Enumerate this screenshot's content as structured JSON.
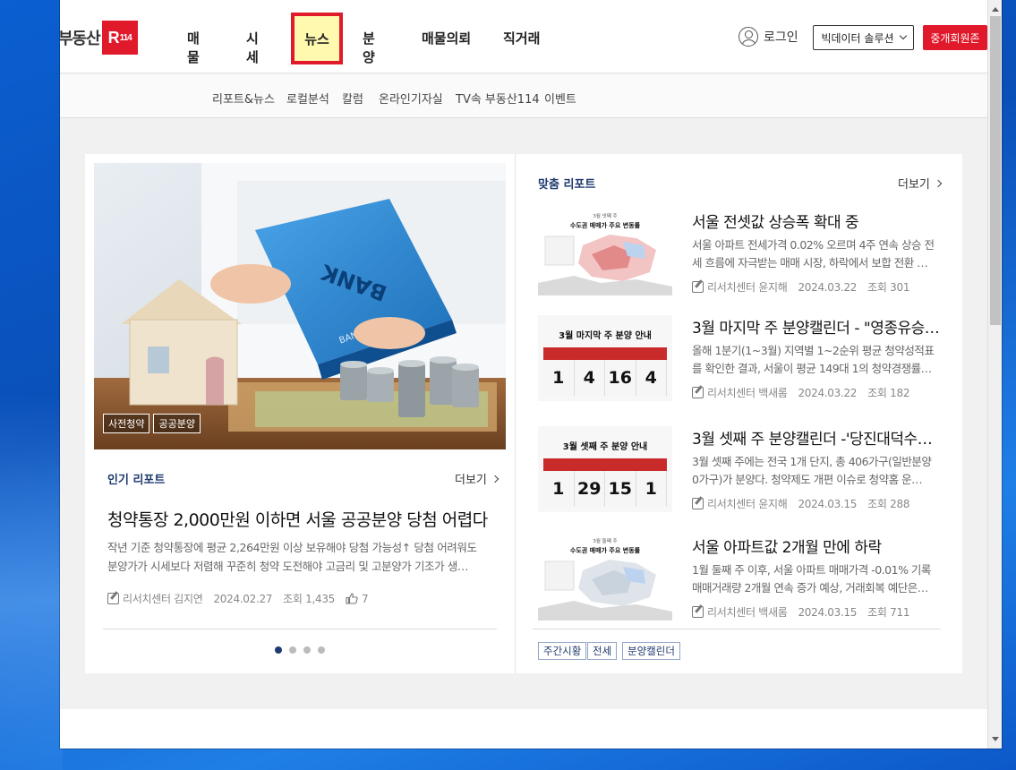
{
  "header": {
    "logo_text": "부동산",
    "logo_box": "R",
    "logo_box_small": "114",
    "nav": [
      "매물",
      "시세",
      "뉴스",
      "분양",
      "매물의뢰",
      "직거래"
    ],
    "login": "로그인",
    "bigdata_label": "빅데이터 솔루션",
    "agent_label": "중개회원존"
  },
  "subnav": [
    "리포트&뉴스",
    "로컬분석",
    "칼럼",
    "온라인기자실",
    "TV속 부동산114",
    "이벤트"
  ],
  "popular": {
    "section_label": "인기 리포트",
    "more": "더보기",
    "tags": [
      "사전청약",
      "공공분양"
    ],
    "title": "청약통장 2,000만원 이하면 서울 공공분양 당첨 어렵다",
    "desc_lines": [
      "작년 기준 청약통장에 평균 2,264만원 이상 보유해야 당첨 가능성↑ 당첨 어려워도",
      "분양가가 시세보다 저렴해 꾸준히 청약 도전해야 고금리 및 고분양가 기조가 생…"
    ],
    "author": "리서치센터 김지연",
    "date": "2024.02.27",
    "views": "조회 1,435",
    "likes": "7",
    "bank_text": "BANK",
    "bank_text2": "BANK"
  },
  "reports": {
    "section_label": "맞춤 리포트",
    "more": "더보기",
    "items": [
      {
        "title": "서울 전셋값 상승폭 확대 중",
        "desc_lines": [
          "서울 아파트 전세가격 0.02% 오르며 4주 연속 상승 전",
          "세 흐름에 자극받는 매매 시장, 하락에서 보합 전환 …"
        ],
        "author": "리서치센터 윤지해",
        "date": "2024.03.22",
        "views": "조회 301",
        "thumb_title_small": "3월 넷째 주",
        "thumb_title": "수도권 매매가 주요 변동률"
      },
      {
        "title": "3월 마지막 주 분양캘린더 - \"영종유승한내들…",
        "desc_lines": [
          "올해 1분기(1~3월) 지역별 1~2순위 평균 청약성적표",
          "를 확인한 결과, 서울이 평균 149대 1의 청약경쟁률…"
        ],
        "author": "리서치센터 백새롬",
        "date": "2024.03.22",
        "views": "조회 182",
        "thumb_title": "3월 마지막 주 분양 안내",
        "thumb_numbers": [
          "1",
          "4",
          "16",
          "4"
        ]
      },
      {
        "title": "3월 셋째 주 분양캘린더 -'당진대덕수…",
        "desc_lines": [
          "3월 셋째 주에는 전국 1개 단지, 총 406가구(일반분양",
          "0가구)가 분양다. 청약제도 개편 이슈로 청약홈 운…"
        ],
        "author": "리서치센터 윤지해",
        "date": "2024.03.15",
        "views": "조회 288",
        "thumb_title": "3월 셋째 주 분양 안내",
        "thumb_numbers": [
          "1",
          "29",
          "15",
          "1"
        ]
      },
      {
        "title": "서울 아파트값 2개월 만에 하락",
        "desc_lines": [
          "1월 둘째 주 이후, 서울 아파트 매매가격 -0.01% 기록",
          "매매거래량 2개월 연속 증가 예상, 거래회복 예단은…"
        ],
        "author": "리서치센터 백새롬",
        "date": "2024.03.15",
        "views": "조회 711",
        "thumb_title_small": "3월 둘째 주",
        "thumb_title": "수도권 매매가 주요 변동률"
      }
    ],
    "keywords": [
      "주간시황",
      "전세",
      "분양캘린더"
    ]
  },
  "colors": {
    "brand_red": "#e0192b",
    "navy": "#1f3a6e",
    "highlight": "#fff9b0"
  }
}
